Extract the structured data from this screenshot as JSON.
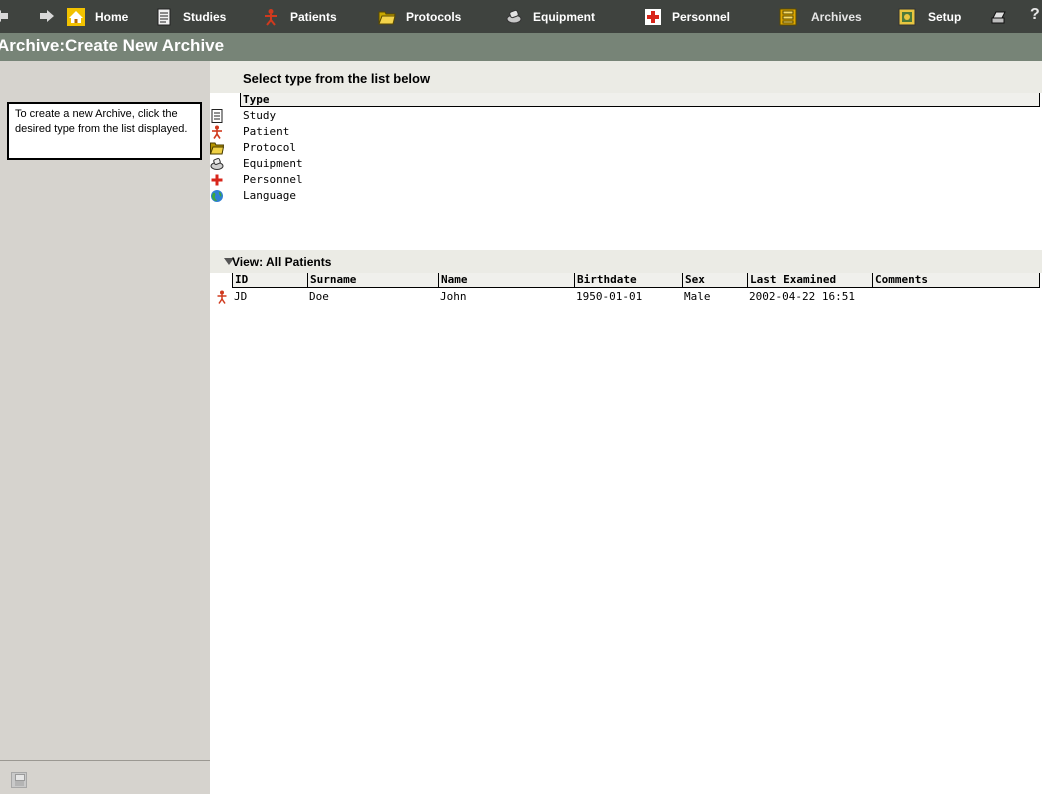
{
  "nav": {
    "back_icon": "back-arrow-icon",
    "forward_icon": "forward-arrow-icon",
    "items": [
      {
        "label": "Home",
        "icon": "home-icon"
      },
      {
        "label": "Studies",
        "icon": "document-icon"
      },
      {
        "label": "Patients",
        "icon": "patient-icon"
      },
      {
        "label": "Protocols",
        "icon": "folder-icon"
      },
      {
        "label": "Equipment",
        "icon": "equipment-icon"
      },
      {
        "label": "Personnel",
        "icon": "red-cross-icon"
      },
      {
        "label": "Archives",
        "icon": "archive-icon"
      },
      {
        "label": "Setup",
        "icon": "setup-icon"
      }
    ],
    "print_icon": "print-icon",
    "help_label": "?"
  },
  "title": "Archive:Create New Archive",
  "sidebar": {
    "help_text": "To create a new Archive, click the desired type from the list displayed.",
    "save_icon": "save-icon"
  },
  "type_section": {
    "title": "Select type from the list below",
    "column_header": "Type",
    "items": [
      {
        "label": "Study",
        "icon": "study-icon"
      },
      {
        "label": "Patient",
        "icon": "patient-icon"
      },
      {
        "label": "Protocol",
        "icon": "protocol-icon"
      },
      {
        "label": "Equipment",
        "icon": "equipment-icon"
      },
      {
        "label": "Personnel",
        "icon": "personnel-icon"
      },
      {
        "label": "Language",
        "icon": "language-globe-icon"
      }
    ]
  },
  "patients_view": {
    "view_label": "View: All Patients",
    "columns": [
      "ID",
      "Surname",
      "Name",
      "Birthdate",
      "Sex",
      "Last Examined",
      "Comments"
    ],
    "rows": [
      {
        "id": "JD",
        "surname": "Doe",
        "name": "John",
        "birthdate": "1950-01-01",
        "sex": "Male",
        "last_examined": "2002-04-22 16:51",
        "comments": ""
      }
    ]
  },
  "colors": {
    "nav_bg": "#3f433f",
    "title_bg": "#778477",
    "sidebar_bg": "#d6d3ce",
    "section_bg": "#ebebe5"
  }
}
